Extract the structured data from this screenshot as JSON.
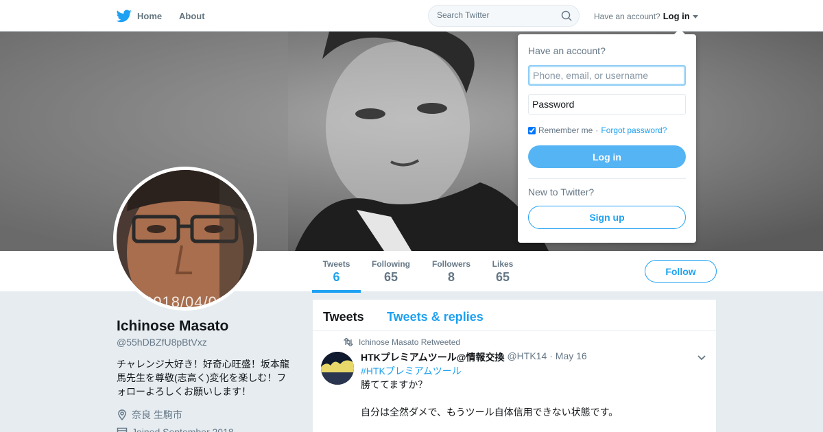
{
  "nav": {
    "home_label": "Home",
    "about_label": "About",
    "search_placeholder": "Search Twitter",
    "have_account": "Have an account?",
    "login_label": "Log in"
  },
  "profile": {
    "name": "Ichinose Masato",
    "handle": "@55hDBZfU8pBtVxz",
    "bio": "チャレンジ大好き！好奇心旺盛！坂本龍馬先生を尊敬(志高く)変化を楽しむ！フォローよろしくお願いします！",
    "location": "奈良 生駒市",
    "joined": "Joined September 2018",
    "avatar_overlay_text": "2018/04/0"
  },
  "stats": [
    {
      "label": "Tweets",
      "value": "6"
    },
    {
      "label": "Following",
      "value": "65"
    },
    {
      "label": "Followers",
      "value": "8"
    },
    {
      "label": "Likes",
      "value": "65"
    }
  ],
  "follow_label": "Follow",
  "timeline": {
    "tab_tweets": "Tweets",
    "tab_replies": "Tweets & replies",
    "tweet": {
      "retweet_context": "Ichinose Masato Retweeted",
      "author_name": "HTKプレミアムツール@情報交換",
      "author_handle": "@HTK14",
      "date": "· May 16",
      "hashtag": "#HTKプレミアムツール",
      "line1": "勝ててますか？",
      "line2": "自分は全然ダメで、もうツール自体信用できない状態です。"
    }
  },
  "login_dropdown": {
    "title": "Have an account?",
    "username_placeholder": "Phone, email, or username",
    "password_placeholder": "Password",
    "remember_label": "Remember me",
    "dot": "·",
    "forgot_label": "Forgot password?",
    "login_button": "Log in",
    "new_label": "New to Twitter?",
    "signup_button": "Sign up"
  },
  "colors": {
    "accent": "#1da1f2",
    "login_button": "#55b4f4",
    "background": "#e6ecf0"
  },
  "icons": [
    "twitter-bird-icon",
    "search-icon",
    "caret-down-icon",
    "location-pin-icon",
    "calendar-icon",
    "retweet-icon",
    "chevron-down-icon"
  ]
}
